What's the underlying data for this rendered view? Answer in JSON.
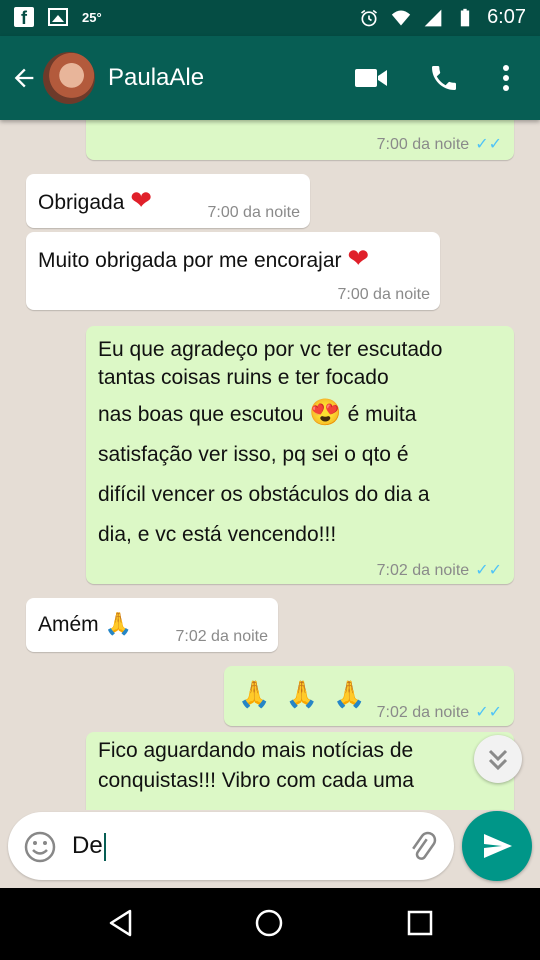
{
  "status_bar": {
    "temperature": "25°",
    "time": "6:07"
  },
  "header": {
    "contact_name": "PaulaAle"
  },
  "messages": [
    {
      "type": "out",
      "meta": "7:00 da noite",
      "status": "✓✓"
    },
    {
      "type": "in",
      "text": "Obrigada",
      "meta": "7:00 da noite"
    },
    {
      "type": "in",
      "text": "Muito obrigada por me encorajar",
      "meta": "7:00 da noite"
    },
    {
      "type": "out",
      "lines": [
        "Eu que agradeço por vc ter escutado",
        "tantas coisas ruins e ter focado",
        "nas boas que escutou",
        "é muita",
        "satisfação ver isso, pq sei o qto é",
        "difícil vencer os obstáculos do dia a",
        "dia, e vc está vencendo!!!"
      ],
      "meta": "7:02 da noite",
      "status": "✓✓"
    },
    {
      "type": "in",
      "text": "Amém",
      "meta": "7:02 da noite"
    },
    {
      "type": "out",
      "text": "🙏 🙏 🙏",
      "meta": "7:02 da noite",
      "status": "✓✓"
    },
    {
      "type": "out",
      "lines": [
        "Fico aguardando mais notícias de",
        "conquistas!!! Vibro com cada uma"
      ]
    }
  ],
  "input": {
    "value": "De"
  }
}
